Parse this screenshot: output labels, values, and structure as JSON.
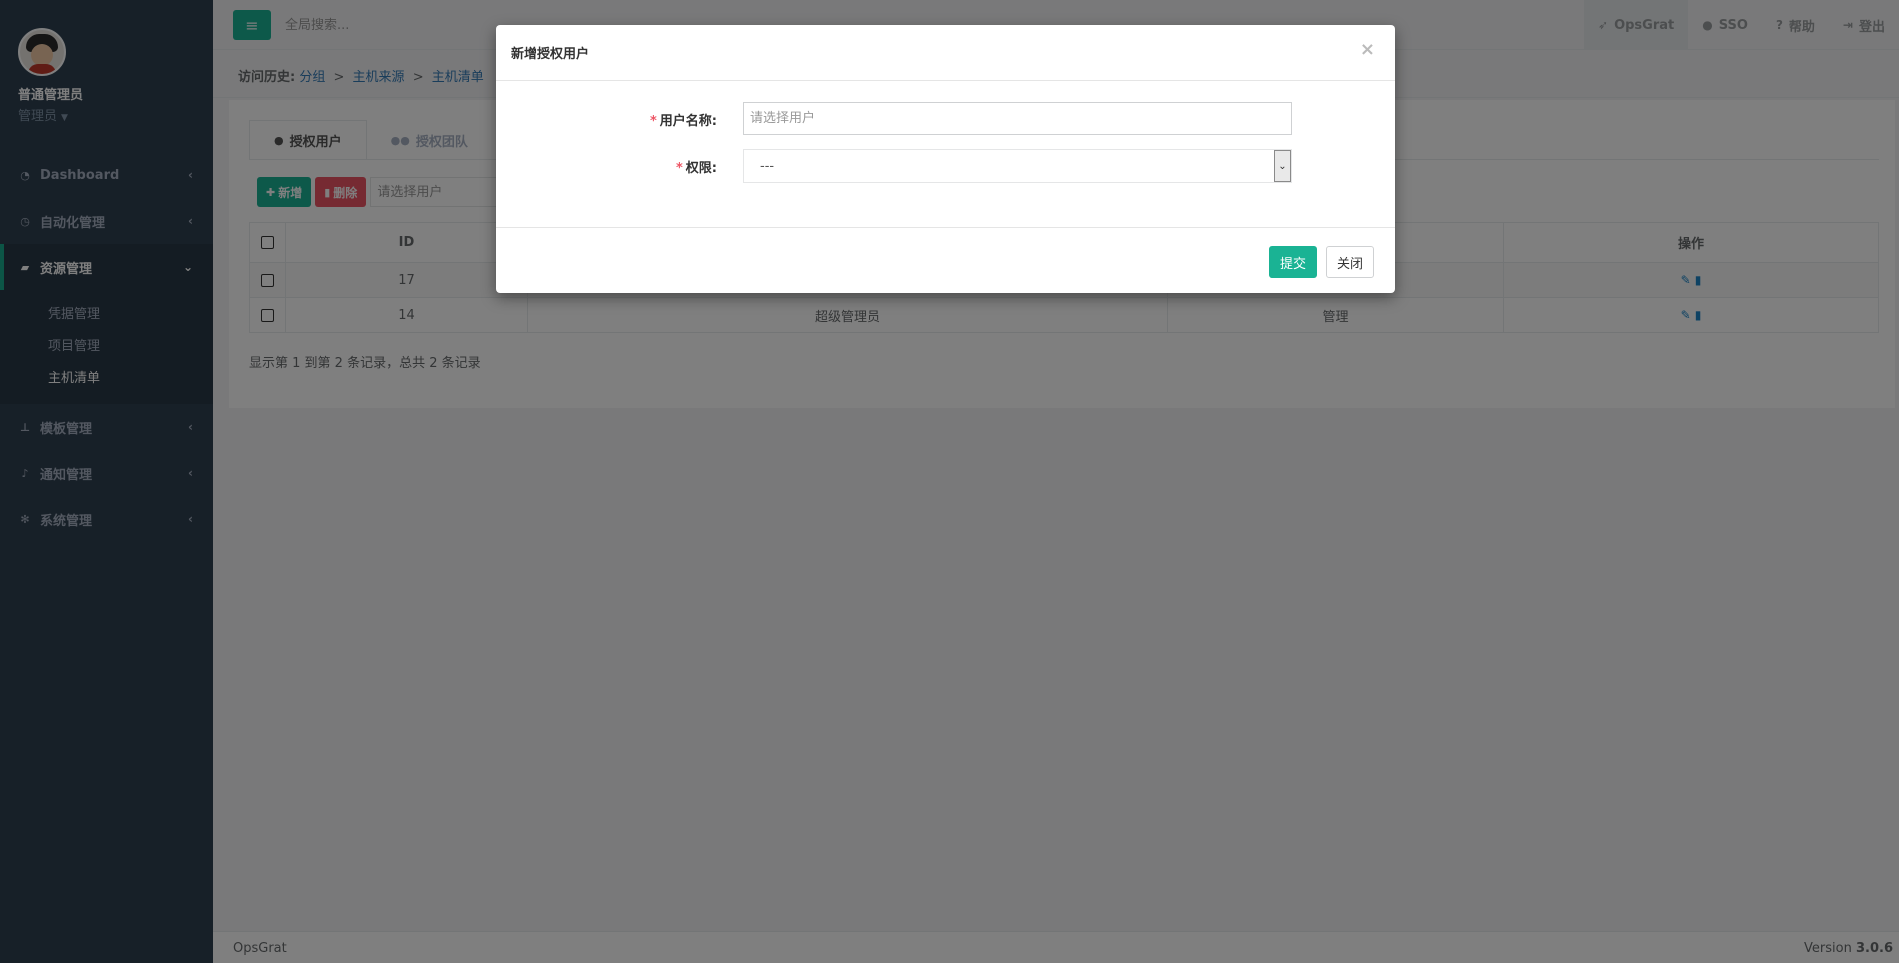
{
  "sidebar": {
    "user_name": "普通管理员",
    "user_role": "管理员",
    "items": [
      {
        "label": "Dashboard",
        "icon": "tachometer-icon"
      },
      {
        "label": "自动化管理",
        "icon": "clock-icon"
      },
      {
        "label": "资源管理",
        "icon": "book-icon"
      },
      {
        "label": "模板管理",
        "icon": "sitemap-icon"
      },
      {
        "label": "通知管理",
        "icon": "bell-icon"
      },
      {
        "label": "系统管理",
        "icon": "gear-icon"
      }
    ],
    "sub_items": [
      "凭据管理",
      "项目管理",
      "主机清单"
    ]
  },
  "topbar": {
    "search_placeholder": "全局搜索...",
    "links": [
      {
        "label": "OpsGrat",
        "icon": "rocket-icon"
      },
      {
        "label": "SSO",
        "icon": "user-icon"
      },
      {
        "label": "帮助",
        "icon": "question-icon"
      },
      {
        "label": "登出",
        "icon": "sign-out-icon"
      }
    ]
  },
  "breadcrumb": {
    "label": "访问历史:",
    "items": [
      "分组",
      "主机来源",
      "主机清单"
    ],
    "separator": ">"
  },
  "tabs": [
    {
      "label": "授权用户",
      "icon": "user-icon"
    },
    {
      "label": "授权团队",
      "icon": "users-icon"
    }
  ],
  "toolbar": {
    "add_label": "新增",
    "delete_label": "删除",
    "filter_placeholder": "请选择用户"
  },
  "table": {
    "columns": [
      "ID",
      "",
      "",
      "操作"
    ],
    "rows": [
      {
        "id": "17",
        "user": "",
        "permission": ""
      },
      {
        "id": "14",
        "user": "超级管理员",
        "permission": "管理"
      }
    ]
  },
  "page_info": "显示第 1 到第 2 条记录，总共 2 条记录",
  "modal": {
    "title": "新增授权用户",
    "close": "×",
    "fields": {
      "username_label": "用户名称:",
      "username_placeholder": "请选择用户",
      "permission_label": "权限:",
      "permission_value": "---"
    },
    "submit_label": "提交",
    "close_label": "关闭"
  },
  "footer": {
    "brand": "OpsGrat",
    "version_prefix": "Version",
    "version": "3.0.6"
  },
  "colors": {
    "sidebar_bg": "#2f4050",
    "accent": "#1ab394",
    "danger": "#ed5565",
    "link": "#337ab7"
  }
}
